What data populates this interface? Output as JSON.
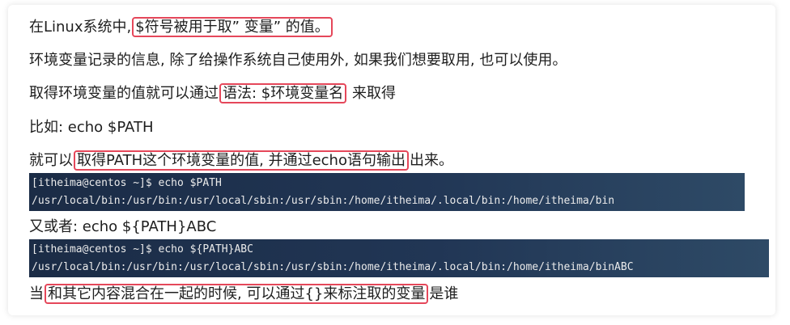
{
  "para1": {
    "prefix": "在Linux系统中,",
    "highlight": "$符号被用于取” 变量” 的值。"
  },
  "para2": "环境变量记录的信息, 除了给操作系统自己使用外, 如果我们想要取用, 也可以使用。",
  "para3": {
    "prefix": "取得环境变量的值就可以通过",
    "highlight": "语法: $环境变量名",
    "suffix": "来取得"
  },
  "para4": "比如:  echo $PATH",
  "para5": {
    "prefix": "就可以",
    "highlight": "取得PATH这个环境变量的值, 并通过echo语句输出",
    "suffix": "出来。"
  },
  "terminal1": {
    "command": "[itheima@centos ~]$ echo $PATH",
    "output": "/usr/local/bin:/usr/bin:/usr/local/sbin:/usr/sbin:/home/itheima/.local/bin:/home/itheima/bin"
  },
  "para6": "又或者: echo ${PATH}ABC",
  "terminal2": {
    "command": "[itheima@centos ~]$ echo ${PATH}ABC",
    "output": "/usr/local/bin:/usr/bin:/usr/local/sbin:/usr/sbin:/home/itheima/.local/bin:/home/itheima/binABC"
  },
  "para7": {
    "prefix": "当",
    "highlight": "和其它内容混合在一起的时候, 可以通过{}来标注取的变量",
    "suffix": "是谁"
  },
  "colors": {
    "highlight_border": "#e5475a",
    "terminal_bg": "#1b2c46",
    "terminal_text": "#ebebeb"
  }
}
